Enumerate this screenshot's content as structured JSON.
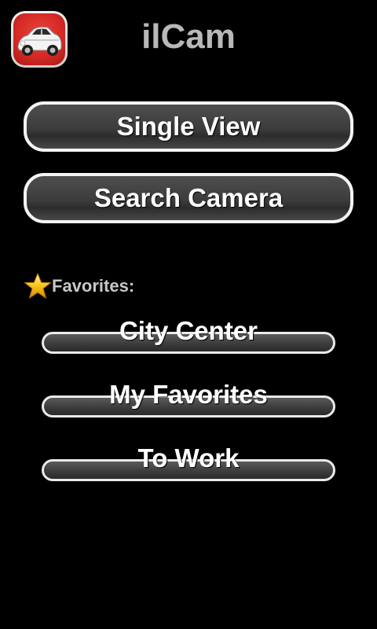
{
  "app": {
    "title": "ilCam",
    "icon": "car-icon"
  },
  "actions": {
    "single_view_label": "Single View",
    "search_camera_label": "Search Camera"
  },
  "favorites": {
    "header_label": "Favorites:",
    "header_icon": "star-icon",
    "items": [
      {
        "label": "City Center"
      },
      {
        "label": "My Favorites"
      },
      {
        "label": "To Work"
      }
    ]
  },
  "colors": {
    "background": "#000000",
    "title": "#b8b8b8",
    "button_border": "#f4f4f4",
    "button_fill": "#3c3c3c",
    "icon_red": "#d62a25",
    "star": "#f5c518"
  }
}
